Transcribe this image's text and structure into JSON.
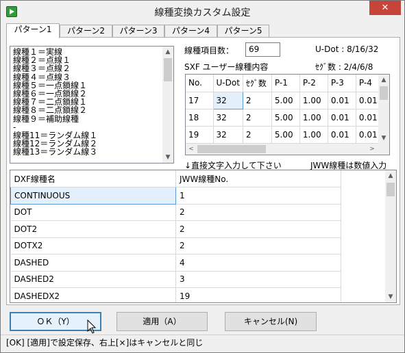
{
  "window": {
    "title": "線種変換カスタム設定",
    "close_label": "✕"
  },
  "tabs": [
    "パターン1",
    "パターン2",
    "パターン3",
    "パターン4",
    "パターン5"
  ],
  "linetype_list": [
    "線種１＝実線",
    "線種２＝点線１",
    "線種３＝点線２",
    "線種４＝点線３",
    "線種５＝一点鎖線１",
    "線種６＝一点鎖線２",
    "線種７＝二点鎖線１",
    "線種８＝二点鎖線２",
    "線種９＝補助線種",
    "‐",
    "線種11＝ランダム線１",
    "線種12＝ランダム線２",
    "線種13＝ランダム線３"
  ],
  "count": {
    "label": "線種項目数：",
    "value": "69"
  },
  "udot_info": "U-Dot : 8/16/32",
  "sxf_title": "SXF ユーザー線種内容",
  "segment_info": "ｾｸﾞ数 : 2/4/6/8",
  "sxf_table": {
    "headers": [
      "No.",
      "U-Dot",
      "ｾｸﾞ数",
      "P-1",
      "P-2",
      "P-3",
      "P-4"
    ],
    "rows": [
      [
        "17",
        "32",
        "2",
        "5.00",
        "1.00",
        "0.01",
        "0.01"
      ],
      [
        "18",
        "32",
        "2",
        "5.00",
        "1.00",
        "0.01",
        "0.01"
      ],
      [
        "19",
        "32",
        "2",
        "5.00",
        "1.00",
        "0.01",
        "0.01"
      ]
    ]
  },
  "hint_left": "↓直接文字入力して下さい",
  "hint_right": "JWW線種は数値入力",
  "dxf_table": {
    "headers": [
      "DXF線種名",
      "JWW線種No."
    ],
    "rows": [
      [
        "CONTINUOUS",
        "1"
      ],
      [
        "DOT",
        "2"
      ],
      [
        "DOT2",
        "2"
      ],
      [
        "DOTX2",
        "2"
      ],
      [
        "DASHED",
        "4"
      ],
      [
        "DASHED2",
        "3"
      ],
      [
        "DASHEDX2",
        "19"
      ]
    ]
  },
  "buttons": {
    "ok": "ＯＫ（Y）",
    "apply": "適用（A）",
    "cancel": "キャンセル(N)"
  },
  "status": "[OK] [適用]で設定保存、右上[×]はキャンセルと同じ",
  "colors": {
    "selection": "#e3f0fb",
    "selection_border": "#5a9bd5",
    "close": "#c7443a",
    "default_button_border": "#3c7fb1"
  }
}
